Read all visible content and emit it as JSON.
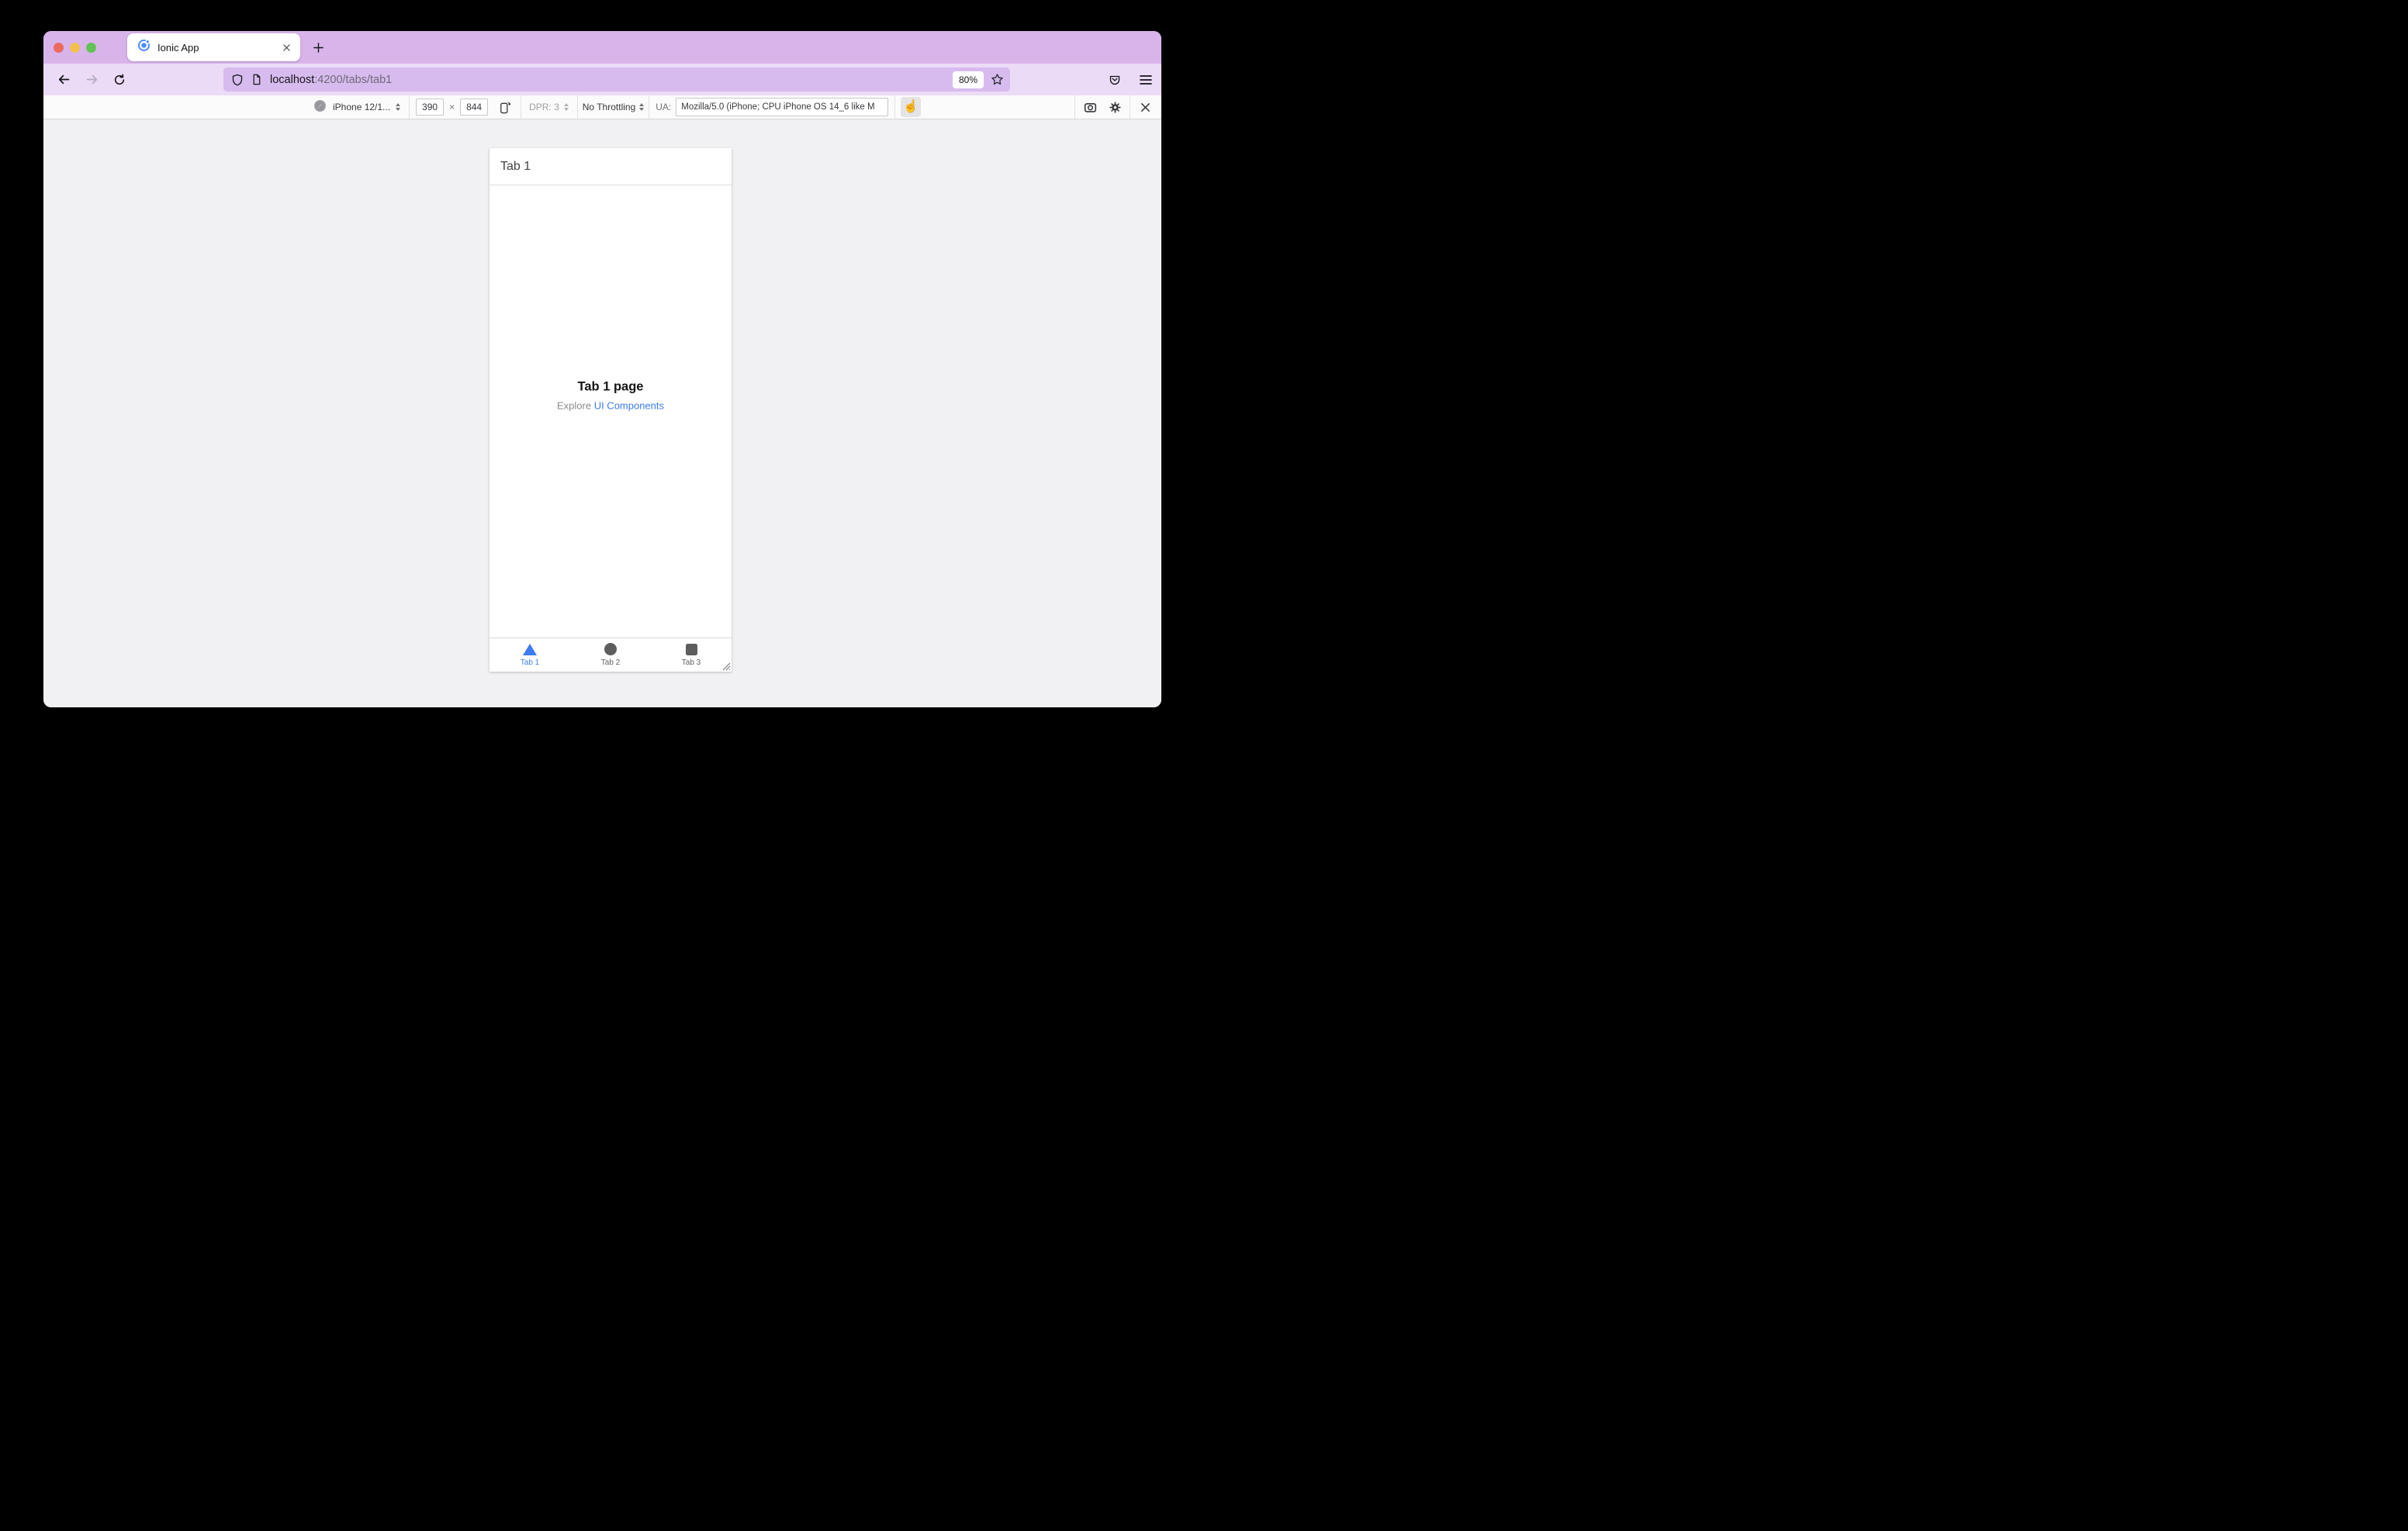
{
  "browser": {
    "tab_title": "Ionic App",
    "url": {
      "host": "localhost",
      "path": ":4200/tabs/tab1"
    },
    "zoom_badge": "80%"
  },
  "rdm": {
    "device_label": "iPhone 12/1...",
    "width_value": "390",
    "times_label": "×",
    "height_value": "844",
    "dpr_label": "DPR: 3",
    "throttling_label": "No Throttling",
    "ua_label": "UA:",
    "ua_value": "Mozilla/5.0 (iPhone; CPU iPhone OS 14_6 like M",
    "touch_glyph": "☝"
  },
  "app": {
    "header_title": "Tab 1",
    "page_title": "Tab 1 page",
    "explore_prefix": "Explore",
    "explore_link": "UI Components",
    "tabs": [
      {
        "label": "Tab 1",
        "icon": "triangle-icon",
        "active": true
      },
      {
        "label": "Tab 2",
        "icon": "ellipse-icon",
        "active": false
      },
      {
        "label": "Tab 3",
        "icon": "square-icon",
        "active": false
      }
    ]
  },
  "colors": {
    "accent": "#3d7cf2",
    "tab-strip-bg": "#d9b4eb",
    "navbar-bg": "#ecdbf6",
    "urlbar-bg": "#d7bbee",
    "toolbar-bg": "#fbfbfb",
    "content-bg": "#f1f1f3",
    "traffic-red": "#ec6a5e",
    "traffic-yellow": "#f5bf4f",
    "traffic-green": "#61c455",
    "app-inactive": "#5d5d5d"
  }
}
